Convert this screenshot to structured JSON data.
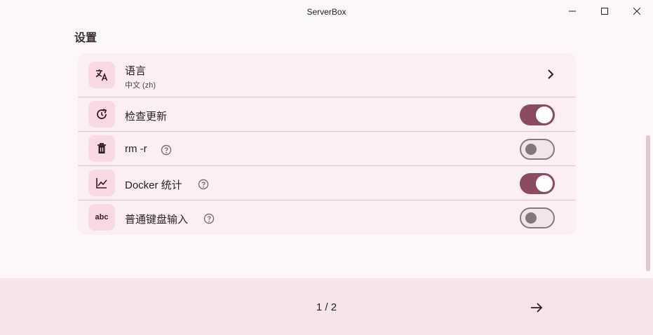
{
  "window": {
    "title": "ServerBox"
  },
  "section": {
    "title": "设置"
  },
  "settings": {
    "language": {
      "label": "语言",
      "value": "中文 (zh)",
      "icon": "translate-icon"
    },
    "check_update": {
      "label": "检查更新",
      "enabled": true,
      "icon": "update-icon"
    },
    "rm_r": {
      "label": "rm -r",
      "enabled": false,
      "icon": "trash-icon"
    },
    "docker_stats": {
      "label": "Docker 统计",
      "enabled": true,
      "icon": "chart-icon"
    },
    "normal_keyboard": {
      "label": "普通键盘输入",
      "enabled": false,
      "icon_text": "abc"
    }
  },
  "footer": {
    "page": "1 / 2"
  },
  "colors": {
    "accent": "#8b4a62",
    "icon_bg": "#f9d9e3",
    "card_bg": "#fbeff2",
    "footer_bg": "#f5e4e8"
  }
}
